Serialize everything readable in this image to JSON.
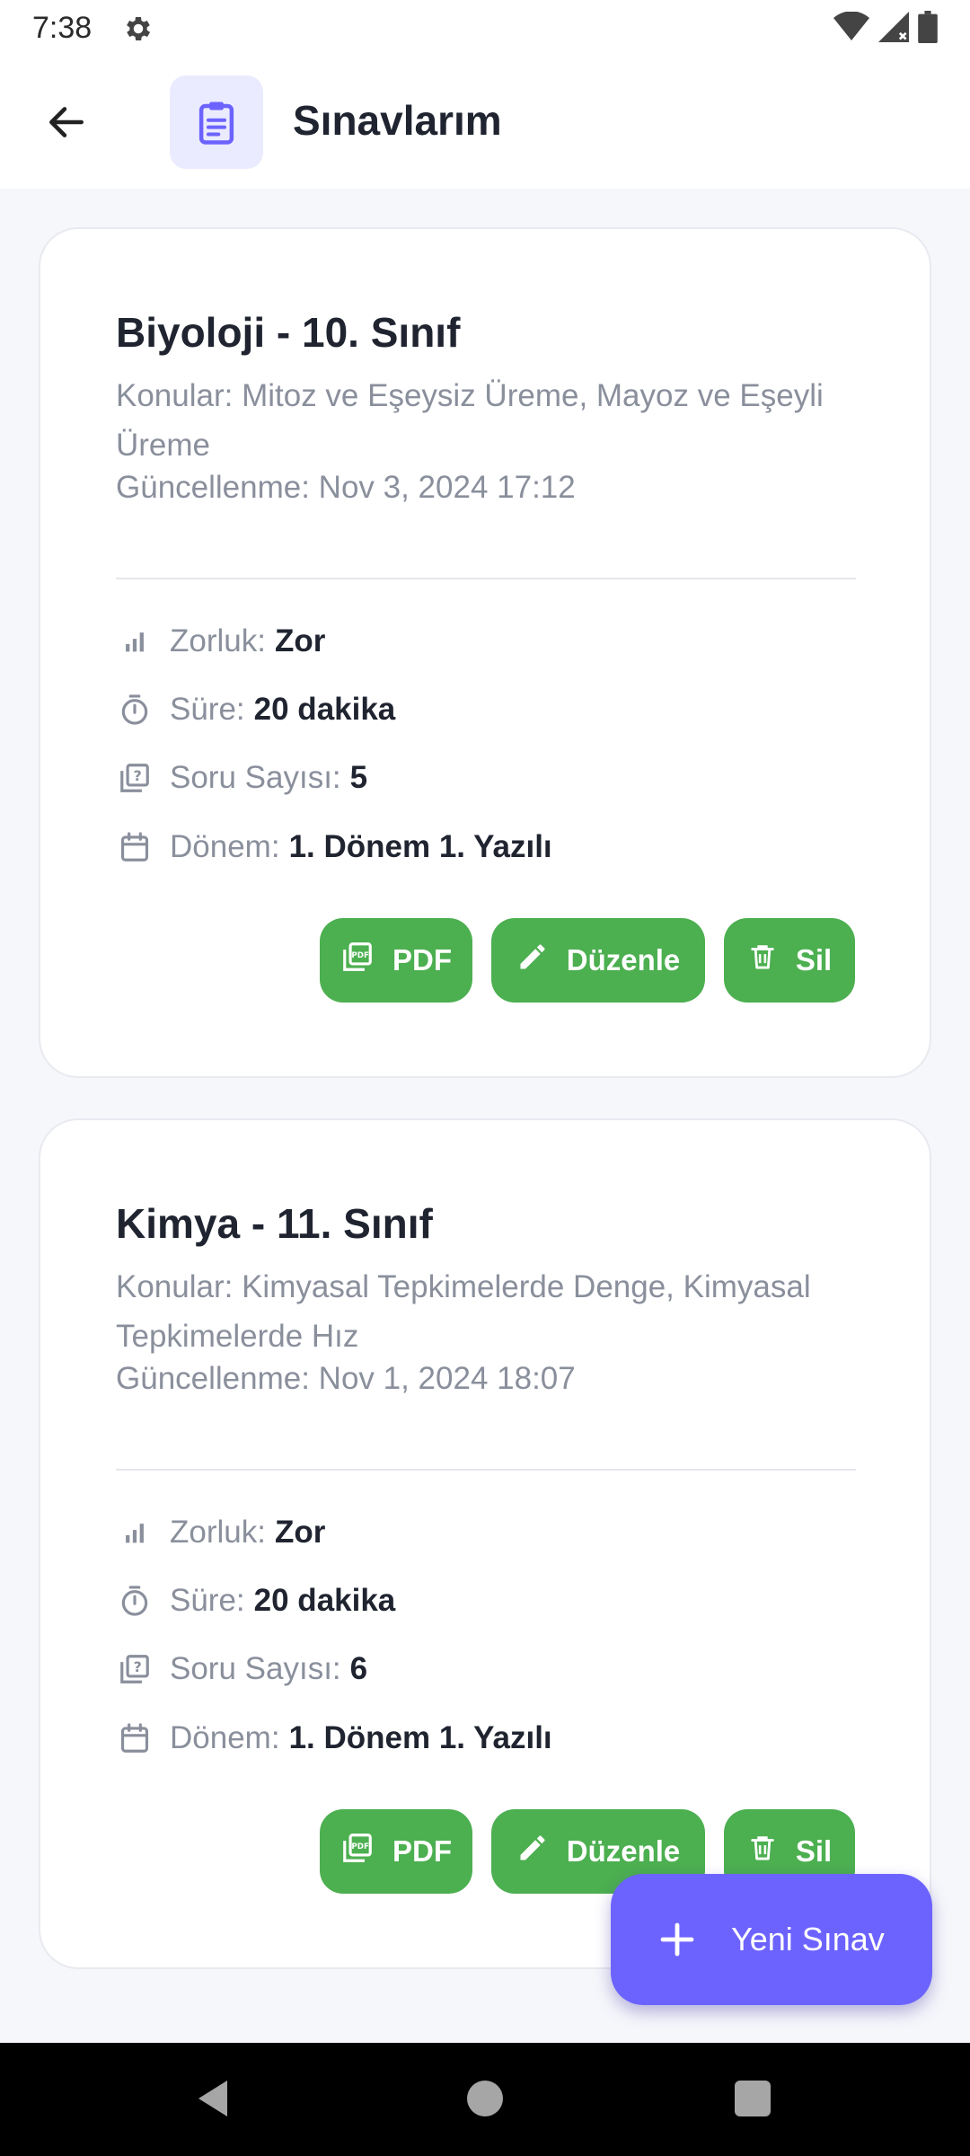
{
  "status_bar": {
    "time": "7:38"
  },
  "header": {
    "title": "Sınavlarım"
  },
  "exams": [
    {
      "title": "Biyoloji - 10. Sınıf",
      "topics": "Konular: Mitoz ve Eşeysiz Üreme, Mayoz ve Eşeyli Üreme",
      "updated": "Güncellenme: Nov 3, 2024 17:12",
      "difficulty_label": "Zorluk:",
      "difficulty_value": "Zor",
      "duration_label": "Süre:",
      "duration_value": "20 dakika",
      "question_count_label": "Soru Sayısı:",
      "question_count_value": "5",
      "term_label": "Dönem:",
      "term_value": "1. Dönem 1. Yazılı",
      "pdf_label": "PDF",
      "edit_label": "Düzenle",
      "delete_label": "Sil"
    },
    {
      "title": "Kimya - 11. Sınıf",
      "topics": "Konular: Kimyasal Tepkimelerde Denge, Kimyasal Tepkimelerde Hız",
      "updated": "Güncellenme: Nov 1, 2024 18:07",
      "difficulty_label": "Zorluk:",
      "difficulty_value": "Zor",
      "duration_label": "Süre:",
      "duration_value": "20 dakika",
      "question_count_label": "Soru Sayısı:",
      "question_count_value": "6",
      "term_label": "Dönem:",
      "term_value": "1. Dönem 1. Yazılı",
      "pdf_label": "PDF",
      "edit_label": "Düzenle",
      "delete_label": "Sil"
    }
  ],
  "fab": {
    "label": "Yeni Sınav"
  },
  "colors": {
    "accent": "#6c63ff",
    "action_green": "#4caf50",
    "icon_bg": "#ebebff",
    "muted_text": "#8a8f9c"
  },
  "icons": {
    "status": [
      "gear-icon",
      "wifi-icon",
      "signal-icon",
      "battery-icon"
    ],
    "header": [
      "back-arrow-icon",
      "clipboard-icon"
    ],
    "card": [
      "bar-chart-icon",
      "timer-icon",
      "question-library-icon",
      "calendar-icon",
      "pdf-icon",
      "pencil-icon",
      "trash-icon"
    ],
    "fab": "plus-icon"
  }
}
